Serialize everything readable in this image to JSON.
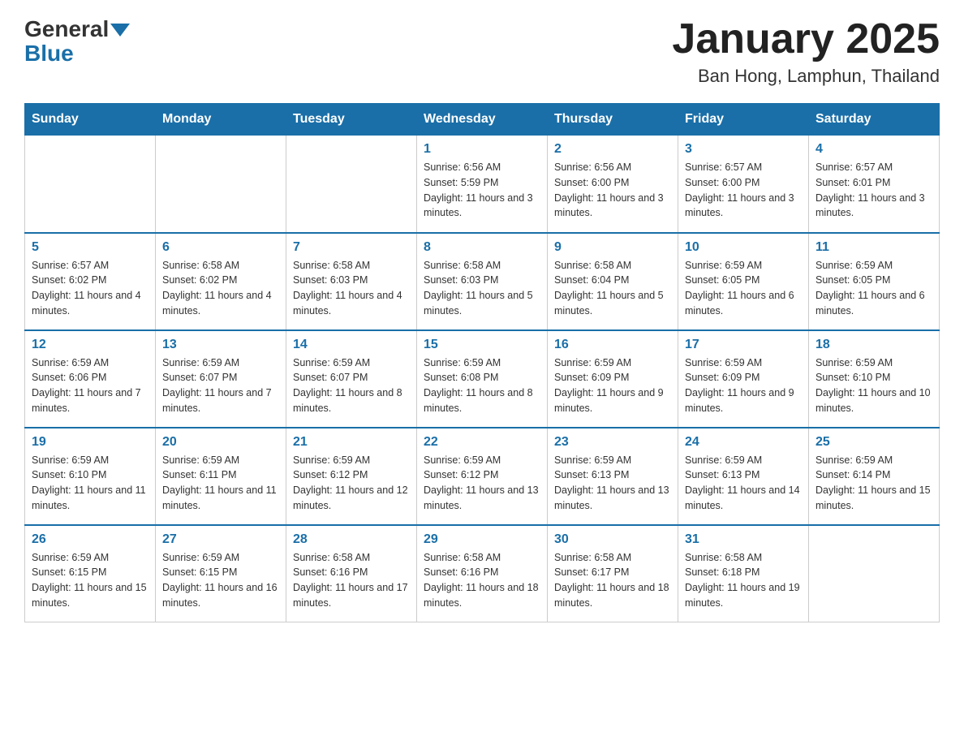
{
  "logo": {
    "general": "General",
    "blue": "Blue"
  },
  "title": "January 2025",
  "location": "Ban Hong, Lamphun, Thailand",
  "days_of_week": [
    "Sunday",
    "Monday",
    "Tuesday",
    "Wednesday",
    "Thursday",
    "Friday",
    "Saturday"
  ],
  "weeks": [
    [
      {
        "day": "",
        "info": ""
      },
      {
        "day": "",
        "info": ""
      },
      {
        "day": "",
        "info": ""
      },
      {
        "day": "1",
        "info": "Sunrise: 6:56 AM\nSunset: 5:59 PM\nDaylight: 11 hours and 3 minutes."
      },
      {
        "day": "2",
        "info": "Sunrise: 6:56 AM\nSunset: 6:00 PM\nDaylight: 11 hours and 3 minutes."
      },
      {
        "day": "3",
        "info": "Sunrise: 6:57 AM\nSunset: 6:00 PM\nDaylight: 11 hours and 3 minutes."
      },
      {
        "day": "4",
        "info": "Sunrise: 6:57 AM\nSunset: 6:01 PM\nDaylight: 11 hours and 3 minutes."
      }
    ],
    [
      {
        "day": "5",
        "info": "Sunrise: 6:57 AM\nSunset: 6:02 PM\nDaylight: 11 hours and 4 minutes."
      },
      {
        "day": "6",
        "info": "Sunrise: 6:58 AM\nSunset: 6:02 PM\nDaylight: 11 hours and 4 minutes."
      },
      {
        "day": "7",
        "info": "Sunrise: 6:58 AM\nSunset: 6:03 PM\nDaylight: 11 hours and 4 minutes."
      },
      {
        "day": "8",
        "info": "Sunrise: 6:58 AM\nSunset: 6:03 PM\nDaylight: 11 hours and 5 minutes."
      },
      {
        "day": "9",
        "info": "Sunrise: 6:58 AM\nSunset: 6:04 PM\nDaylight: 11 hours and 5 minutes."
      },
      {
        "day": "10",
        "info": "Sunrise: 6:59 AM\nSunset: 6:05 PM\nDaylight: 11 hours and 6 minutes."
      },
      {
        "day": "11",
        "info": "Sunrise: 6:59 AM\nSunset: 6:05 PM\nDaylight: 11 hours and 6 minutes."
      }
    ],
    [
      {
        "day": "12",
        "info": "Sunrise: 6:59 AM\nSunset: 6:06 PM\nDaylight: 11 hours and 7 minutes."
      },
      {
        "day": "13",
        "info": "Sunrise: 6:59 AM\nSunset: 6:07 PM\nDaylight: 11 hours and 7 minutes."
      },
      {
        "day": "14",
        "info": "Sunrise: 6:59 AM\nSunset: 6:07 PM\nDaylight: 11 hours and 8 minutes."
      },
      {
        "day": "15",
        "info": "Sunrise: 6:59 AM\nSunset: 6:08 PM\nDaylight: 11 hours and 8 minutes."
      },
      {
        "day": "16",
        "info": "Sunrise: 6:59 AM\nSunset: 6:09 PM\nDaylight: 11 hours and 9 minutes."
      },
      {
        "day": "17",
        "info": "Sunrise: 6:59 AM\nSunset: 6:09 PM\nDaylight: 11 hours and 9 minutes."
      },
      {
        "day": "18",
        "info": "Sunrise: 6:59 AM\nSunset: 6:10 PM\nDaylight: 11 hours and 10 minutes."
      }
    ],
    [
      {
        "day": "19",
        "info": "Sunrise: 6:59 AM\nSunset: 6:10 PM\nDaylight: 11 hours and 11 minutes."
      },
      {
        "day": "20",
        "info": "Sunrise: 6:59 AM\nSunset: 6:11 PM\nDaylight: 11 hours and 11 minutes."
      },
      {
        "day": "21",
        "info": "Sunrise: 6:59 AM\nSunset: 6:12 PM\nDaylight: 11 hours and 12 minutes."
      },
      {
        "day": "22",
        "info": "Sunrise: 6:59 AM\nSunset: 6:12 PM\nDaylight: 11 hours and 13 minutes."
      },
      {
        "day": "23",
        "info": "Sunrise: 6:59 AM\nSunset: 6:13 PM\nDaylight: 11 hours and 13 minutes."
      },
      {
        "day": "24",
        "info": "Sunrise: 6:59 AM\nSunset: 6:13 PM\nDaylight: 11 hours and 14 minutes."
      },
      {
        "day": "25",
        "info": "Sunrise: 6:59 AM\nSunset: 6:14 PM\nDaylight: 11 hours and 15 minutes."
      }
    ],
    [
      {
        "day": "26",
        "info": "Sunrise: 6:59 AM\nSunset: 6:15 PM\nDaylight: 11 hours and 15 minutes."
      },
      {
        "day": "27",
        "info": "Sunrise: 6:59 AM\nSunset: 6:15 PM\nDaylight: 11 hours and 16 minutes."
      },
      {
        "day": "28",
        "info": "Sunrise: 6:58 AM\nSunset: 6:16 PM\nDaylight: 11 hours and 17 minutes."
      },
      {
        "day": "29",
        "info": "Sunrise: 6:58 AM\nSunset: 6:16 PM\nDaylight: 11 hours and 18 minutes."
      },
      {
        "day": "30",
        "info": "Sunrise: 6:58 AM\nSunset: 6:17 PM\nDaylight: 11 hours and 18 minutes."
      },
      {
        "day": "31",
        "info": "Sunrise: 6:58 AM\nSunset: 6:18 PM\nDaylight: 11 hours and 19 minutes."
      },
      {
        "day": "",
        "info": ""
      }
    ]
  ]
}
